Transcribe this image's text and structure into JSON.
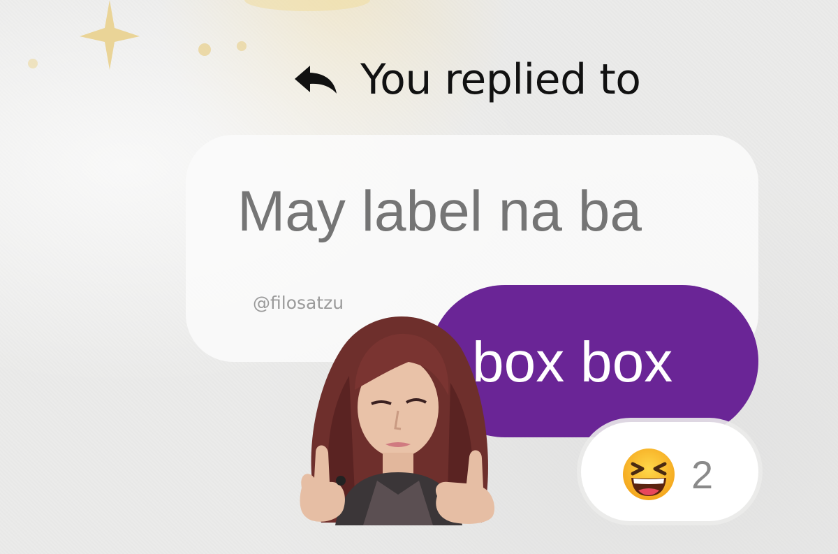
{
  "reply_header": {
    "icon": "reply-arrow-icon",
    "text": "You replied to"
  },
  "quoted_message": {
    "text": "May label na ba"
  },
  "watermark": {
    "text": "@filosatzu"
  },
  "sent_message": {
    "text": "box box"
  },
  "sticker": {
    "icon": "thumbs-up-sticker"
  },
  "reaction": {
    "emoji_icon": "laughing-squinting-face-icon",
    "count": "2"
  },
  "colors": {
    "sent_bubble": "#6a2596",
    "quoted_text": "#757575",
    "background": "#ebebea"
  }
}
